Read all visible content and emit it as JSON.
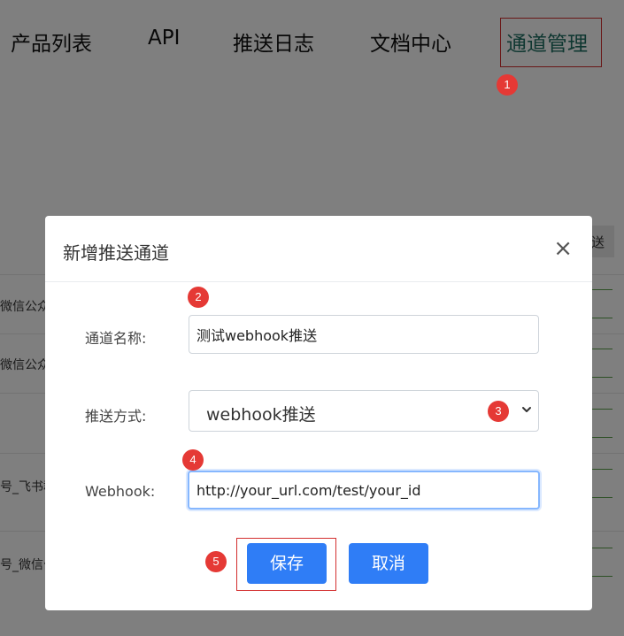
{
  "nav": {
    "items": [
      {
        "label": "产品列表",
        "active": false
      },
      {
        "label": "API",
        "active": false
      },
      {
        "label": "推送日志",
        "active": false
      },
      {
        "label": "文档中心",
        "active": false
      },
      {
        "label": "通道管理",
        "active": true
      }
    ]
  },
  "background": {
    "top_button_fragment": "送",
    "rows": [
      {
        "text": "微信公众"
      },
      {
        "text": "微信公众"
      },
      {
        "text": ""
      },
      {
        "text": "号_飞书群"
      },
      {
        "text": "号_微信公"
      }
    ]
  },
  "modal": {
    "title": "新增推送通道",
    "close_symbol": "×",
    "fields": {
      "channel_name": {
        "label": "通道名称:",
        "value": "测试webhook推送"
      },
      "push_method": {
        "label": "推送方式:",
        "selected": "webhook推送"
      },
      "webhook": {
        "label": "Webhook:",
        "value": "http://your_url.com/test/your_id"
      }
    },
    "buttons": {
      "save": "保存",
      "cancel": "取消"
    }
  },
  "markers": [
    "1",
    "2",
    "3",
    "4",
    "5"
  ],
  "colors": {
    "primary": "#2f7df6",
    "active_nav": "#1f6f62",
    "marker": "#e53935",
    "highlight_border": "#d32f2f"
  }
}
